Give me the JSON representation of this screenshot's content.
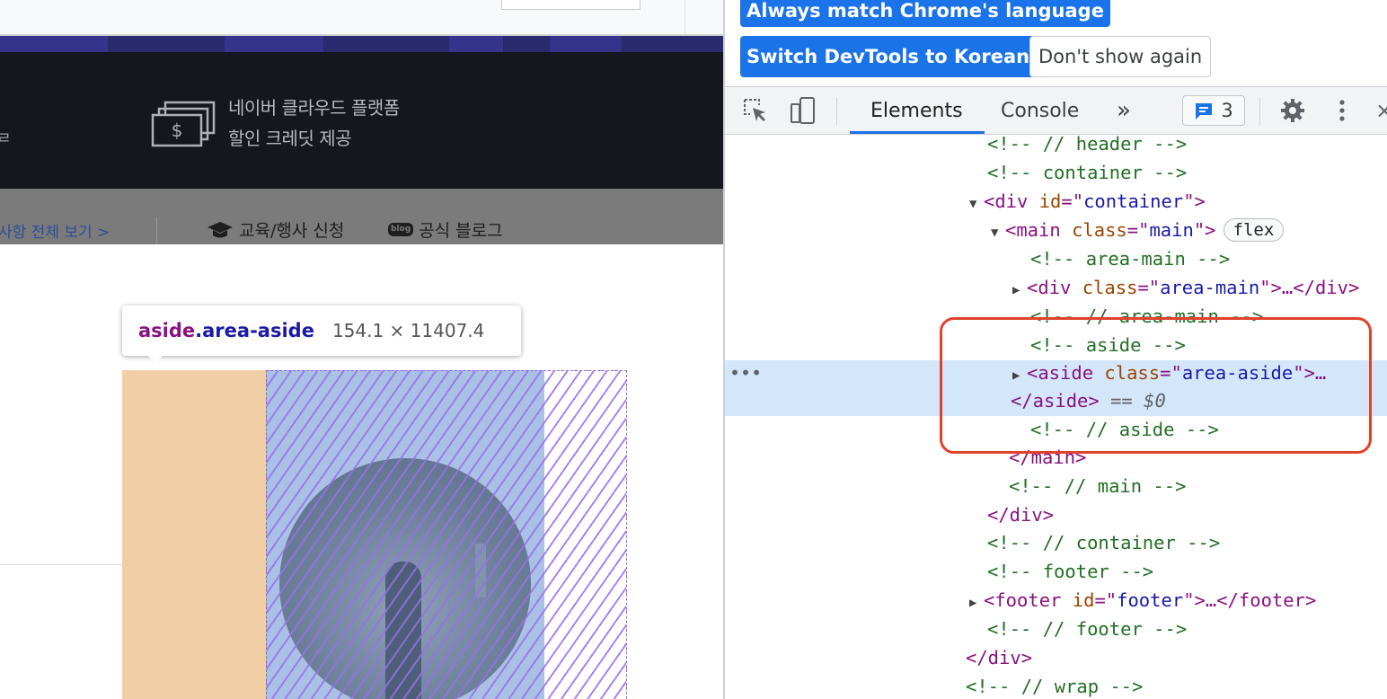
{
  "page": {
    "banner": {
      "line1": "네이버 클라우드 플랫폼",
      "line2": "할인 크레딧 제공",
      "left_glyph": "ㄹ",
      "icon": "dollar-bills-icon"
    },
    "subnav": {
      "notice_link": "사항 전체 보기 >",
      "education": "교육/행사 신청",
      "blog_badge": "blog",
      "blog": "공식 블로그"
    },
    "tooltip": {
      "tag": "aside",
      "class": ".area-aside",
      "size": "154.1 × 11407.4"
    },
    "colors": {
      "margin": "#f2cea6",
      "content": "#a8c1e4",
      "hatch": "#9d6df0"
    }
  },
  "devtools": {
    "lang_prompt": {
      "match_button": "Always match Chrome's language",
      "switch_button": "Switch DevTools to Korean",
      "dismiss_button": "Don't show again"
    },
    "toolbar": {
      "inspect_icon": "inspect-element-icon",
      "device_icon": "device-toolbar-icon",
      "tabs": [
        "Elements",
        "Console"
      ],
      "more_tabs": "»",
      "issues_count": "3",
      "settings_icon": "gear-icon",
      "menu_icon": "kebab-menu-icon"
    },
    "dom": {
      "r0": "<!-- // header -->",
      "r1": "<!-- container -->",
      "r2_tag": "div",
      "r2_attr": "id",
      "r2_val": "container",
      "r3_tag": "main",
      "r3_attr": "class",
      "r3_val": "main",
      "r3_badge": "flex",
      "r4": "<!-- area-main -->",
      "r5_tag": "div",
      "r5_attr": "class",
      "r5_val": "area-main",
      "r6": "<!-- // area-main -->",
      "r7": "<!-- aside -->",
      "r8_tag": "aside",
      "r8_attr": "class",
      "r8_val": "area-aside",
      "r9_close": "</aside>",
      "r9_eq": "==",
      "r9_dollar": "$0",
      "r10": "<!-- // aside -->",
      "r11": "</main>",
      "r12": "<!-- // main -->",
      "r13": "</div>",
      "r14": "<!-- // container -->",
      "r15": "<!-- footer -->",
      "r16_tag": "footer",
      "r16_attr": "id",
      "r16_val": "footer",
      "r17": "<!-- // footer -->",
      "r18": "</div>",
      "r19": "<!-- // wrap -->"
    }
  }
}
